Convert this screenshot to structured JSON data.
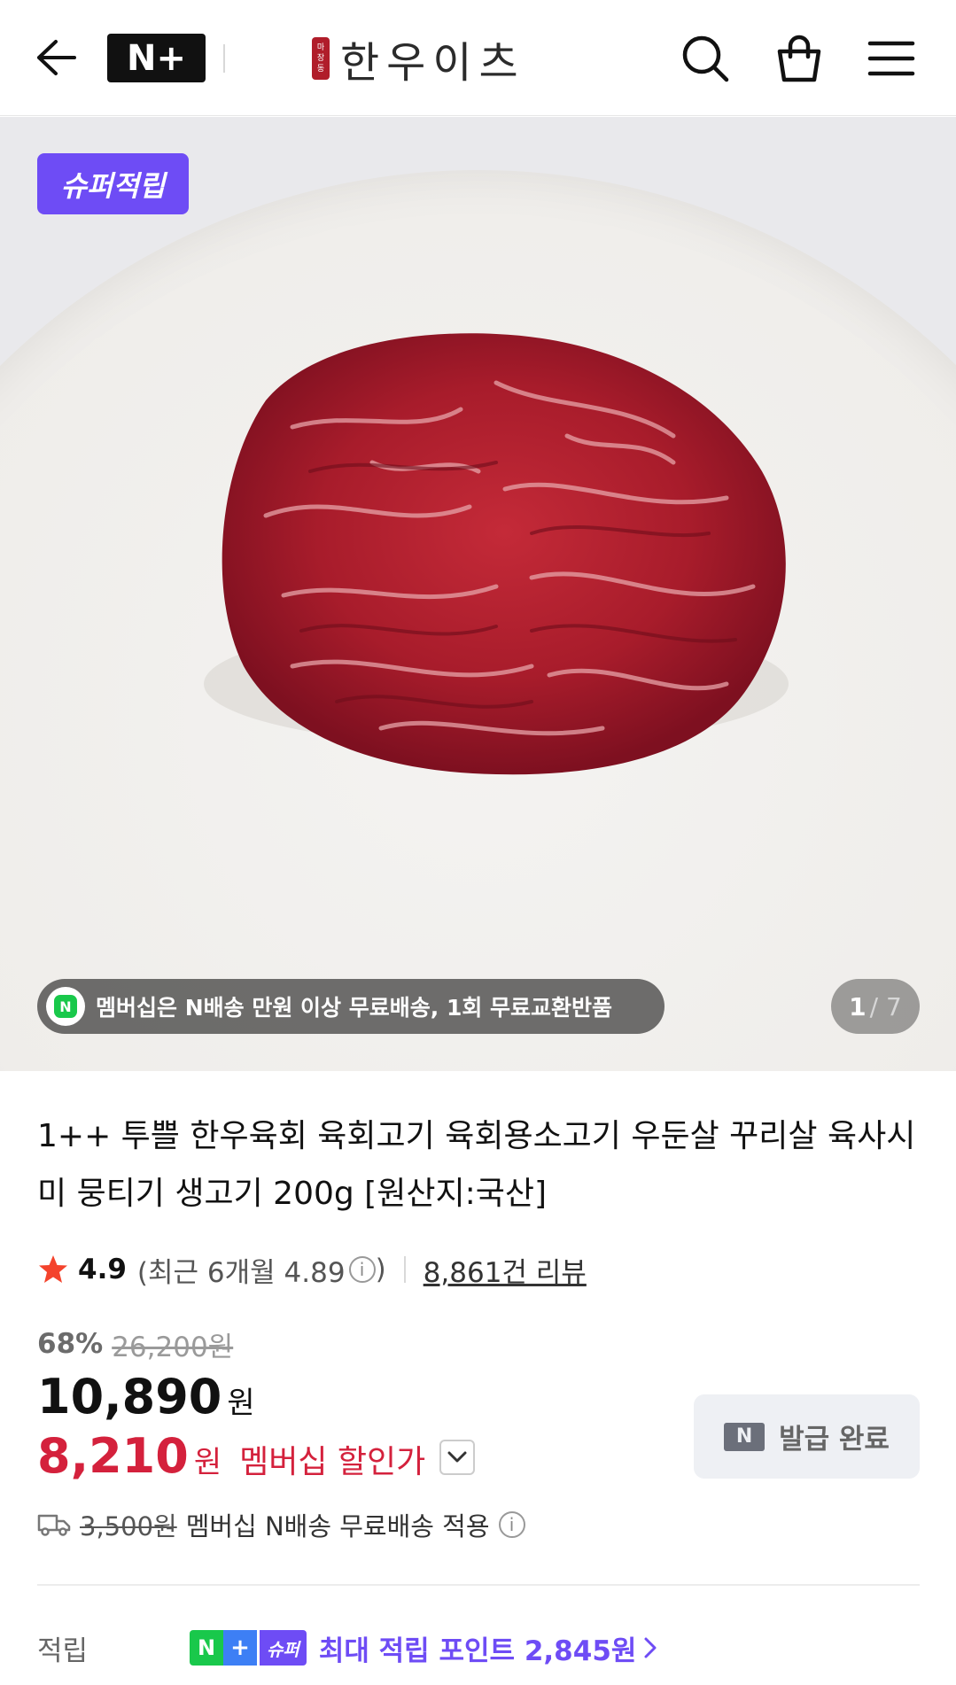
{
  "header": {
    "nplus_label": "N+",
    "logo_text": "한우이츠",
    "logo_seal": [
      "마",
      "장",
      "동"
    ]
  },
  "hero": {
    "badge": "슈퍼적립",
    "notice": "멤버십은 N배송 만원 이상 무료배송, 1회 무료교환반품",
    "page_current": "1",
    "page_total": "/ 7"
  },
  "product": {
    "title": "1++ 투쁠 한우육회 육회고기 육회용소고기 우둔살 꾸리살 육사시미 뭉티기 생고기 200g [원산지:국산]",
    "rating": "4.9",
    "rating_recent": "(최근 6개월 4.89",
    "rating_recent_close": ")",
    "reviews": "8,861건 리뷰",
    "discount_pct": "68%",
    "original_price": "26,200원",
    "price": "10,890",
    "price_unit": "원",
    "member_price": "8,210",
    "member_unit": "원",
    "member_label": "멤버십 할인가",
    "coupon_label": "발급 완료",
    "coupon_icon": "N",
    "ship_fee": "3,500원",
    "ship_text": "멤버십 N배송 무료배송 적용"
  },
  "points": {
    "label": "적립",
    "tag_n": "N",
    "tag_plus": "+",
    "tag_super": "슈퍼",
    "text": "최대 적립 포인트 2,845원"
  },
  "colors": {
    "accent_purple": "#6e4cf5",
    "price_red": "#d4213c",
    "naver_green": "#19c84b"
  }
}
